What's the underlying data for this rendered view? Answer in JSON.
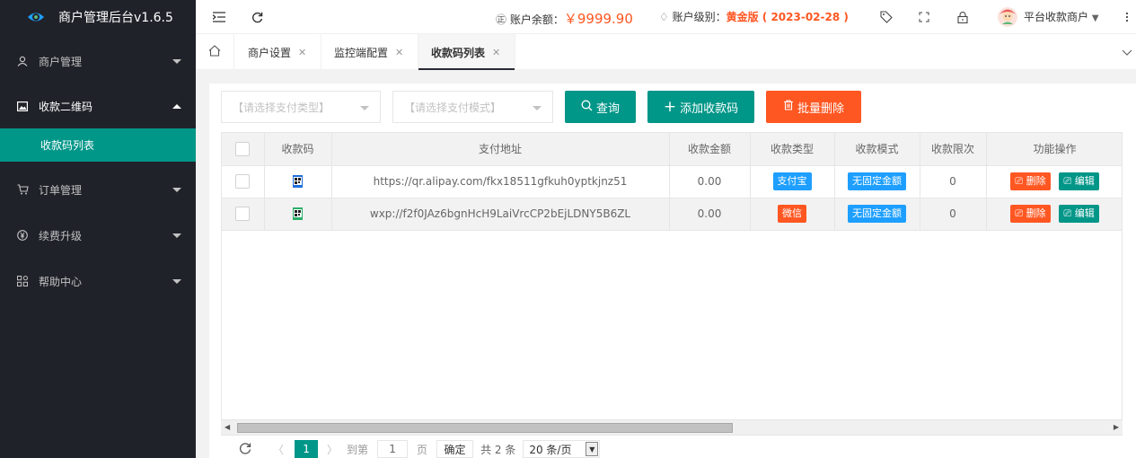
{
  "app": {
    "title": "商户管理后台v1.6.5"
  },
  "sidebar": {
    "items": [
      {
        "label": "商户管理",
        "icon": "user-icon",
        "open": false
      },
      {
        "label": "收款二维码",
        "icon": "image-icon",
        "open": true,
        "children": [
          {
            "label": "收款码列表",
            "active": true
          }
        ]
      },
      {
        "label": "订单管理",
        "icon": "cart-icon",
        "open": false
      },
      {
        "label": "续费升级",
        "icon": "yen-circle-icon",
        "open": false
      },
      {
        "label": "帮助中心",
        "icon": "apps-icon",
        "open": false
      }
    ]
  },
  "header": {
    "balance_label": "账户余额：",
    "balance_value": "￥9999.90",
    "level_label": "账户级别：",
    "level_value": "黄金版 ( 2023-02-28 )",
    "user_name": "平台收款商户",
    "icons": [
      "menu-fold-icon",
      "refresh-icon",
      "tag-icon",
      "fullscreen-icon",
      "lock-icon",
      "more-icon"
    ]
  },
  "tabs": [
    {
      "label": "商户设置",
      "active": false
    },
    {
      "label": "监控端配置",
      "active": false
    },
    {
      "label": "收款码列表",
      "active": true
    }
  ],
  "toolbar": {
    "pay_type_placeholder": "【请选择支付类型】",
    "pay_mode_placeholder": "【请选择支付模式】",
    "search_label": "查询",
    "add_label": "添加收款码",
    "batch_delete_label": "批量删除"
  },
  "colors": {
    "sidebar_bg": "#20222a",
    "accent": "#009688",
    "danger": "#ff5722",
    "info": "#1e9fff",
    "alipay_badge": "#1e9fff",
    "wechat_badge": "#ff5722"
  },
  "table": {
    "columns": [
      "收款码",
      "支付地址",
      "收款金额",
      "收款类型",
      "收款模式",
      "收款限次",
      "功能操作"
    ],
    "rows": [
      {
        "qr_icon": "alipay-qr-icon",
        "address": "https://qr.alipay.com/fkx18511gfkuh0yptkjnz51",
        "amount": "0.00",
        "type": "支付宝",
        "type_color": "#1e9fff",
        "mode": "无固定金额",
        "limit": "0",
        "delete_label": "删除",
        "edit_label": "编辑"
      },
      {
        "qr_icon": "wechat-qr-icon",
        "address": "wxp://f2f0JAz6bgnHcH9LaiVrcCP2bEjLDNY5B6ZL",
        "amount": "0.00",
        "type": "微信",
        "type_color": "#ff5722",
        "mode": "无固定金额",
        "limit": "0",
        "delete_label": "删除",
        "edit_label": "编辑"
      }
    ]
  },
  "pager": {
    "current_page": "1",
    "goto_label": "到第",
    "goto_value": "1",
    "page_unit": "页",
    "confirm_label": "确定",
    "total_label": "共 2 条",
    "page_size": "20 条/页"
  }
}
